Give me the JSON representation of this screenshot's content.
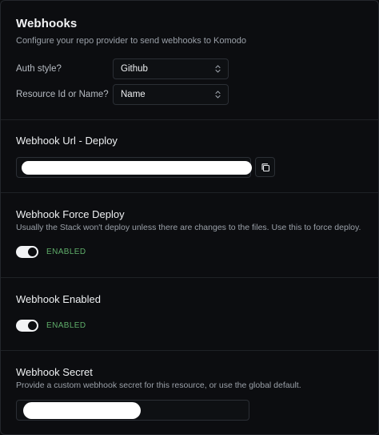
{
  "header": {
    "title": "Webhooks",
    "subtitle": "Configure your repo provider to send webhooks to Komodo"
  },
  "auth_style": {
    "label": "Auth style?",
    "value": "Github"
  },
  "resource_id": {
    "label": "Resource Id or Name?",
    "value": "Name"
  },
  "webhook_url": {
    "title": "Webhook Url - Deploy",
    "copy_icon": "copy-icon"
  },
  "force_deploy": {
    "title": "Webhook Force Deploy",
    "description": "Usually the Stack won't deploy unless there are changes to the files. Use this to force deploy.",
    "state_label": "ENABLED",
    "enabled": true
  },
  "webhook_enabled": {
    "title": "Webhook Enabled",
    "state_label": "ENABLED",
    "enabled": true
  },
  "secret": {
    "title": "Webhook Secret",
    "description": "Provide a custom webhook secret for this resource, or use the global default."
  },
  "colors": {
    "background": "#0c0d10",
    "enabled_text": "#5fae6a",
    "switch_on": "#f2f3f5"
  }
}
